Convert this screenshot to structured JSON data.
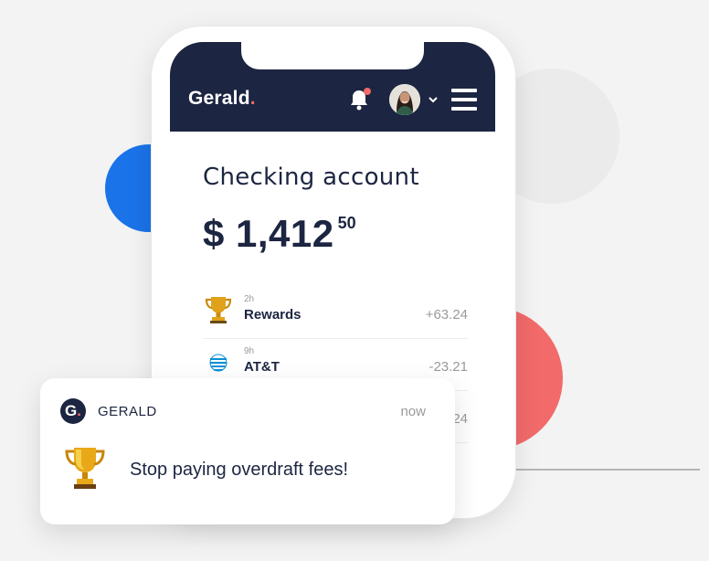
{
  "app": {
    "logo": "Gerald",
    "logo_dot": "."
  },
  "header": {
    "bell_icon": "bell-icon",
    "menu_icon": "hamburger-menu-icon",
    "avatar_icon": "user-avatar"
  },
  "account": {
    "title": "Checking account",
    "balance_main": "$ 1,412",
    "balance_cents": "50"
  },
  "transactions": [
    {
      "time": "2h",
      "name": "Rewards",
      "amount": "+63.24",
      "icon": "trophy-icon"
    },
    {
      "time": "9h",
      "name": "AT&T",
      "amount": "-23.21",
      "icon": "att-logo-icon"
    },
    {
      "time": "",
      "name": "",
      "amount": "24",
      "icon": ""
    }
  ],
  "notification": {
    "logo_letter": "G",
    "logo_dot": ".",
    "app_name": "GERALD",
    "time": "now",
    "message": "Stop paying overdraft fees!",
    "icon": "trophy-icon"
  },
  "colors": {
    "navy": "#1c2541",
    "accent_red": "#f26a6a",
    "accent_blue": "#1a73e8",
    "muted": "#9a9a9a"
  }
}
